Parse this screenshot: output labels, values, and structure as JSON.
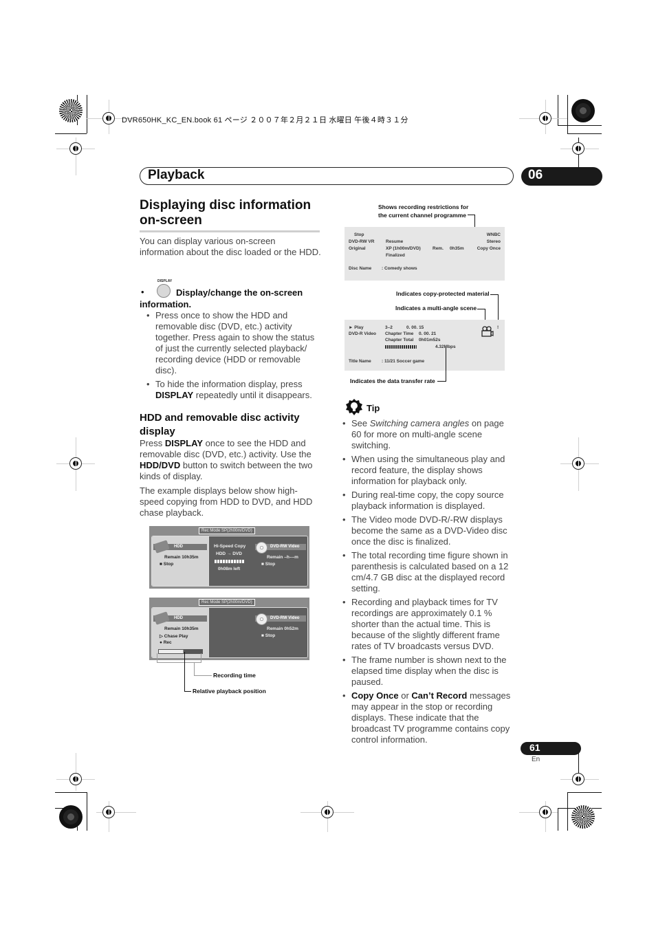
{
  "header": {
    "file_info": "DVR650HK_KC_EN.book 61 ページ ２００７年２月２１日 水曜日 午後４時３１分"
  },
  "chapter": {
    "title": "Playback",
    "number": "06"
  },
  "section": {
    "title": "Displaying disc information on-screen",
    "intro": "You can display various on-screen information about the disc loaded or the HDD.",
    "display_button_label": "DISPLAY",
    "step_title": "Display/change the on-screen information.",
    "step_bullets": [
      {
        "text": "Press once to show the HDD and removable disc (DVD, etc.) activity together. Press again to show the status of just the currently selected playback/ recording device (HDD or removable disc)."
      },
      {
        "pre": "To hide the information display, press ",
        "bold": "DISPLAY",
        "post": " repeatedly until it disappears."
      }
    ]
  },
  "subsection": {
    "title": "HDD and removable disc activity display",
    "p1": {
      "t1": "Press ",
      "b1": "DISPLAY",
      "t2": " once to see the HDD and removable disc (DVD, etc.) activity. Use the ",
      "b2": "HDD/DVD",
      "t3": " button to switch between the two kinds of display."
    },
    "p2": "The example displays below show high-speed copying from HDD to DVD, and HDD chase playback."
  },
  "osd1": {
    "rec_mode": "Rec Mode   SP(2h00m/DVD)",
    "hdd_label": "HDD",
    "hdd_remain": "Remain  10h35m",
    "hdd_status": "■ Stop",
    "mid_line1": "Hi-Speed Copy",
    "mid_line2": "HDD → DVD",
    "mid_progress": 1.0,
    "mid_line3": "0h08m left",
    "dvd_label": "DVD-RW Video",
    "dvd_remain": "Remain  –h––m",
    "dvd_status": "■ Stop"
  },
  "osd2": {
    "rec_mode": "Rec Mode   SP(2h00m/DVD)",
    "hdd_label": "HDD",
    "hdd_remain": "Remain  10h35m",
    "hdd_status1": "▷ Chase Play",
    "hdd_status2": "● Rec",
    "relative_position": 0.56,
    "dvd_label": "DVD-RW Video",
    "dvd_remain": "Remain  0h52m",
    "dvd_status": "■ Stop",
    "callout_recording_time": "Recording time",
    "callout_relative_position": "Relative playback position"
  },
  "info1": {
    "callout": "Shows recording restrictions for the current channel programme",
    "status": "Stop",
    "disc_type": "DVD-RW  VR",
    "disc_state": "Original",
    "resume": "Resume",
    "mode": "XP (1h00m/DVD)",
    "finalized": "Finalized",
    "rem_label": "Rem.",
    "rem_value": "0h35m",
    "channel": "WNBC",
    "audio": "Stereo",
    "copy": "Copy Once",
    "disc_name_label": "Disc Name",
    "disc_name_value": ":  Comedy shows"
  },
  "info2": {
    "callout_copy": "Indicates copy-protected material",
    "callout_angle": "Indicates a multi-angle scene",
    "callout_rate": "Indicates the data transfer rate",
    "status": "► Play",
    "disc_type": "DVD-R   Video",
    "title_chapter": "3–2",
    "elapsed": "0. 00. 15",
    "chapter_time_label": "Chapter Time",
    "chapter_time": "0. 00. 21",
    "chapter_total_label": "Chapter Total",
    "chapter_total": "0h01m52s",
    "bitrate": "4.32Mbps",
    "copy_mark": "!",
    "title_name_label": "Title Name",
    "title_name_value": ":  11/21 Soccer game"
  },
  "tip": {
    "label": "Tip",
    "items": [
      {
        "pre": "See ",
        "italic": "Switching camera angles",
        "post": " on page 60 for more on multi-angle scene switching."
      },
      {
        "text": "When using the simultaneous play and record feature, the display shows information for playback only."
      },
      {
        "text": "During real-time copy, the copy source playback information is displayed."
      },
      {
        "text": "The Video mode DVD-R/-RW displays become the same as a DVD-Video disc once the disc is finalized."
      },
      {
        "text": "The total recording time figure shown in parenthesis is calculated based on a 12 cm/4.7 GB disc at the displayed record setting."
      },
      {
        "text": "Recording and playback times for TV recordings are approximately 0.1 % shorter than the actual time. This is because of the slightly different frame rates of TV broadcasts versus DVD."
      },
      {
        "text": "The frame number is shown next to the elapsed time display when the disc is paused."
      },
      {
        "b1": "Copy Once",
        "t1": " or ",
        "b2": "Can’t Record",
        "t2": " messages may appear in the stop or recording displays. These indicate that the broadcast TV programme contains copy control information."
      }
    ]
  },
  "footer": {
    "page_number": "61",
    "language": "En"
  }
}
